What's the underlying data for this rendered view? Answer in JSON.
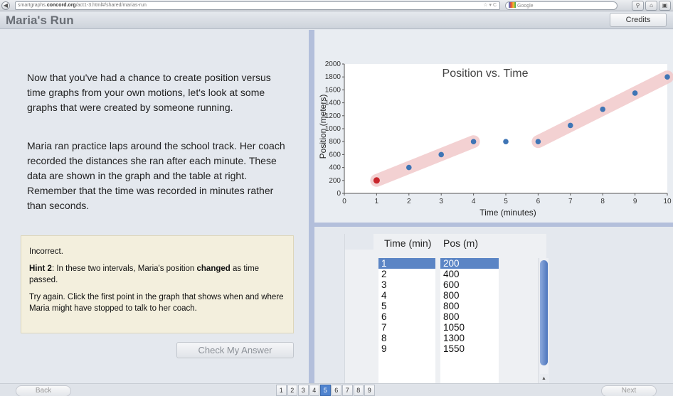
{
  "browser": {
    "url_prefix": "smartgraphs.",
    "url_domain": "concord.org",
    "url_path": "/act1-3.html#/shared/marias-run",
    "url_icons": "☆ ▾ C",
    "search_placeholder": "Google"
  },
  "header": {
    "title": "Maria's Run",
    "credits_label": "Credits"
  },
  "intro": {
    "para1": "Now that you've had a chance to create position versus time graphs from your own motions, let's look at some graphs that were created by someone running.",
    "para2": "Maria ran practice laps around the school track. Her coach recorded the distances she ran after each minute. These data are shown in the graph and the table at right. Remember that the time was recorded in minutes rather than seconds."
  },
  "hint": {
    "status": "Incorrect.",
    "hint_label": "Hint 2",
    "hint_text_a": ": In these two intervals, Maria's position ",
    "hint_bold": "changed",
    "hint_text_b": " as time passed.",
    "retry": "Try again. Click the first point in the graph that shows when and where Maria might have stopped to talk to her coach."
  },
  "check_button_label": "Check My Answer",
  "chart_data": {
    "type": "scatter",
    "title": "Position vs. Time",
    "xlabel": "Time (minutes)",
    "ylabel": "Position (meters)",
    "xlim": [
      0,
      10
    ],
    "ylim": [
      0,
      2000
    ],
    "x_ticks": [
      0,
      1,
      2,
      3,
      4,
      5,
      6,
      7,
      8,
      9,
      10
    ],
    "y_ticks": [
      0,
      200,
      400,
      600,
      800,
      1000,
      1200,
      1400,
      1600,
      1800,
      2000
    ],
    "x": [
      1,
      2,
      3,
      4,
      5,
      6,
      7,
      8,
      9,
      10
    ],
    "y": [
      200,
      400,
      600,
      800,
      800,
      800,
      1050,
      1300,
      1550,
      1800
    ],
    "selected_point_index": 0,
    "highlight_intervals": [
      [
        1,
        4
      ],
      [
        6,
        10
      ]
    ],
    "colors": {
      "point": "#3f75b5",
      "selected": "#c8262c",
      "highlight": "#f2c9cb"
    }
  },
  "table": {
    "headers": [
      "Time (min)",
      "Pos (m)"
    ],
    "time": [
      "1",
      "2",
      "3",
      "4",
      "5",
      "6",
      "7",
      "8",
      "9"
    ],
    "pos": [
      "200",
      "400",
      "600",
      "800",
      "800",
      "800",
      "1050",
      "1300",
      "1550"
    ],
    "selected_row": 0
  },
  "nav": {
    "back_label": "Back",
    "next_label": "Next",
    "pages": [
      "1",
      "2",
      "3",
      "4",
      "5",
      "6",
      "7",
      "8",
      "9"
    ],
    "active_page": "5"
  }
}
